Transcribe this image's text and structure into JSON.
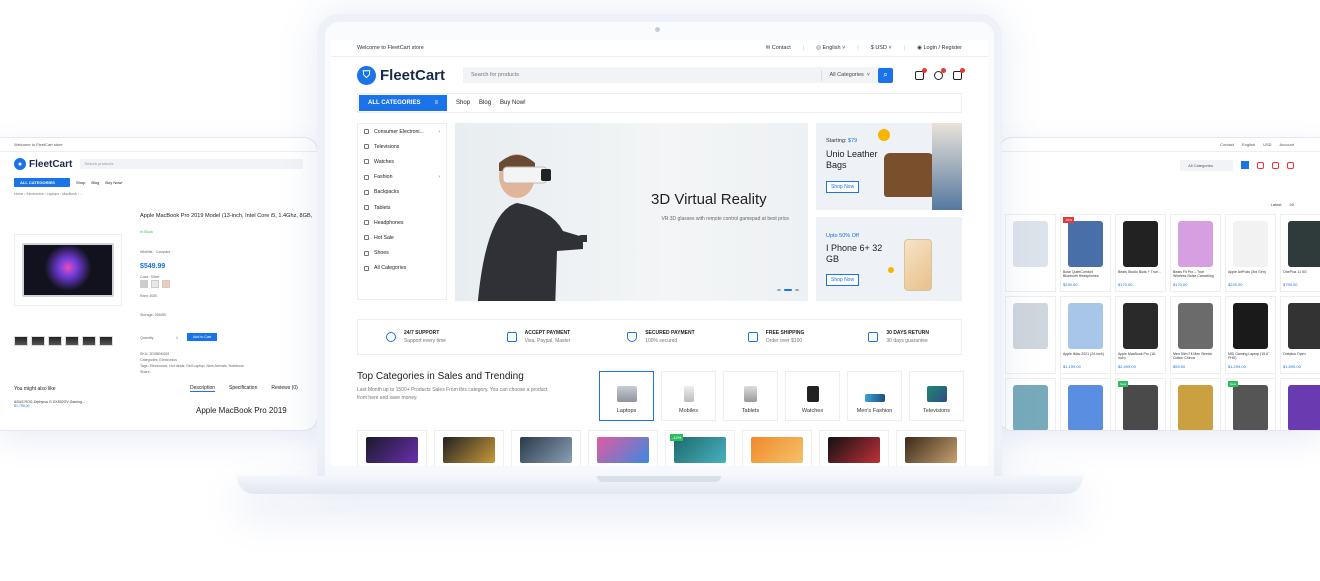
{
  "main": {
    "topbar": {
      "welcome": "Welcome to FleetCart store",
      "contact": "Contact",
      "language": "English",
      "currency": "USD",
      "login": "Login / Register"
    },
    "brand": "FleetCart",
    "search": {
      "placeholder": "Search for products",
      "category": "All Categories"
    },
    "nav": {
      "all_categories": "ALL CATEGORIES",
      "links": [
        "Shop",
        "Blog",
        "Buy Now!"
      ]
    },
    "menu": [
      "Consumer Electroni...",
      "Televisions",
      "Watches",
      "Fashion",
      "Backpacks",
      "Tablets",
      "Headphones",
      "Hot Sale",
      "Shoes",
      "All Categories"
    ],
    "hero": {
      "title": "3D Virtual Reality",
      "subtitle": "VR 3D glasses with remote control gamepad at best price"
    },
    "promo1": {
      "starting": "Starting:",
      "price": "$79",
      "title": "Unio Leather Bags",
      "button": "Shop Now"
    },
    "promo2": {
      "upto": "Upto",
      "off": "50% Off",
      "title": "I Phone 6+ 32 GB",
      "button": "Shop Now"
    },
    "features": [
      {
        "title": "24/7 SUPPORT",
        "sub": "Support every time"
      },
      {
        "title": "ACCEPT PAYMENT",
        "sub": "Visa, Paypal, Master"
      },
      {
        "title": "SECURED PAYMENT",
        "sub": "100% secured"
      },
      {
        "title": "FREE SHIPPING",
        "sub": "Order over $100"
      },
      {
        "title": "30 DAYS RETURN",
        "sub": "30 days guarantee"
      }
    ],
    "top_categories": {
      "title": "Top Categories in Sales and Trending",
      "desc": "Last Month up to 1500+ Products Sales From this category. You can choose a product from here and save money.",
      "items": [
        "Laptops",
        "Mobiles",
        "Tablets",
        "Watches",
        "Men's Fashion",
        "Televisions"
      ]
    },
    "discount_badge": "-12%"
  },
  "left": {
    "welcome": "Welcome to FleetCart store",
    "brand": "FleetCart",
    "search_placeholder": "Search products",
    "all_categories": "ALL CATEGORIES",
    "links": [
      "Shop",
      "Blog",
      "Buy Now!"
    ],
    "product_title": "Apple MacBook Pro 2019 Model (13-inch, Intel Core i5, 1.4Ghz, 8GB,",
    "in_stock": "In Stock",
    "wishlist": "Wishlist",
    "compare": "Compare",
    "price": "$549.99",
    "color_label": "Color: Silver",
    "ram_label": "Ram: 8GB",
    "storage_label": "Storage: 256GB",
    "quantity_label": "Quantity",
    "quantity": "1",
    "add_to_cart": "Add to Cart",
    "sku": "SKU: 3D9BBK009",
    "categories": "Categories: Electronics",
    "tags": "Tags: Electronics, Hot deals, Dell Laptop, New Arrivals, Notebook",
    "share": "Share:",
    "you_might": "You might also like",
    "tabs": [
      "Description",
      "Specification",
      "Reviews (0)"
    ],
    "desc_title": "Apple MacBook Pro 2019",
    "mini_product": "ASUS ROG Zephyrus G GX502GV Gaming...",
    "mini_price": "$1,799.00"
  },
  "right": {
    "contact": "Contact",
    "language": "English",
    "currency": "USD",
    "account": "Account",
    "category": "All Categories",
    "sort": "Latest",
    "per_page": "20",
    "badge_sale": "-50%",
    "badge_new": "New",
    "products": [
      {
        "t": "",
        "p": ""
      },
      {
        "t": "Bose QuietComfort Bluetooth Headphones",
        "p": "$240.00"
      },
      {
        "t": "Beats Studio Buds + True...",
        "p": "$170.00"
      },
      {
        "t": "Beats Fit Pro – True Wireless Noise Cancelling Earbuds",
        "p": "$170.00"
      },
      {
        "t": "Apple AirPods (3rd Gen)",
        "p": "$229.00"
      },
      {
        "t": "OnePlus 11 5G",
        "p": "$799.00"
      },
      {
        "t": "",
        "p": ""
      },
      {
        "t": "Apple iMac 2021 (24-inch)",
        "p": "$1,199.00"
      },
      {
        "t": "Apple MacBook Pro (16-inch)",
        "p": "$2,499.00"
      },
      {
        "t": "Men Slim Fit Men Stretch Cotton Chinos",
        "p": "$59.00"
      },
      {
        "t": "MSI Gaming Laptop (15.6\" FHD)",
        "p": "$1,299.00"
      },
      {
        "t": "Oneplus Open",
        "p": "$1,699.00"
      },
      {
        "t": "",
        "p": ""
      },
      {
        "t": "",
        "p": ""
      },
      {
        "t": "",
        "p": ""
      },
      {
        "t": "",
        "p": ""
      },
      {
        "t": "",
        "p": ""
      },
      {
        "t": "",
        "p": ""
      }
    ]
  },
  "colors": {
    "accent": "#1a73e8",
    "sale": "#e33b3b",
    "green": "#2ebd5d"
  }
}
